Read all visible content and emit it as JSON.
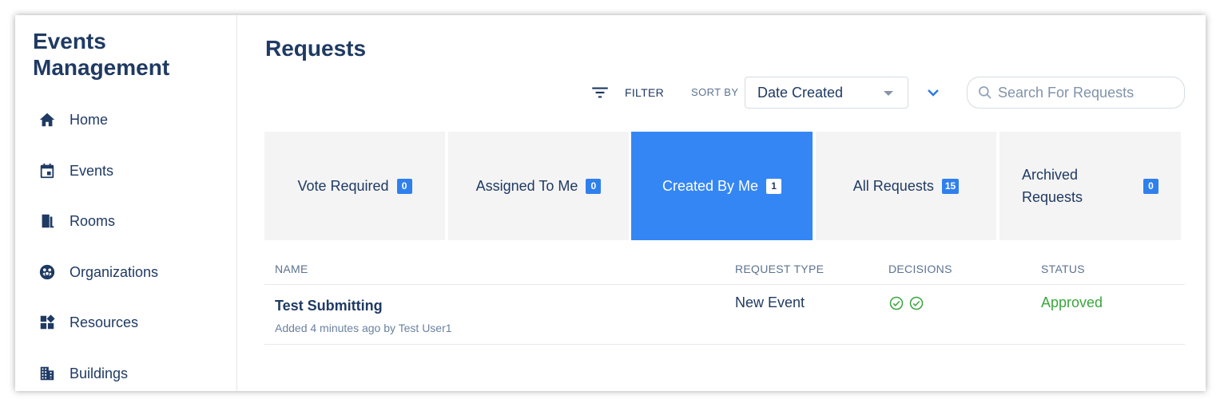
{
  "app": {
    "title": "Events Management"
  },
  "sidebar": {
    "items": [
      {
        "label": "Home",
        "icon": "home-icon"
      },
      {
        "label": "Events",
        "icon": "calendar-icon"
      },
      {
        "label": "Rooms",
        "icon": "door-icon"
      },
      {
        "label": "Organizations",
        "icon": "organizations-icon"
      },
      {
        "label": "Resources",
        "icon": "resources-icon"
      },
      {
        "label": "Buildings",
        "icon": "building-icon"
      }
    ]
  },
  "page": {
    "title": "Requests"
  },
  "toolbar": {
    "filter_label": "FILTER",
    "sort_label": "SORT BY",
    "sort_value": "Date Created",
    "search_placeholder": "Search For Requests"
  },
  "tabs": [
    {
      "label": "Vote Required",
      "count": "0",
      "active": false
    },
    {
      "label": "Assigned To Me",
      "count": "0",
      "active": false
    },
    {
      "label": "Created By Me",
      "count": "1",
      "active": true
    },
    {
      "label": "All Requests",
      "count": "15",
      "active": false
    },
    {
      "label": "Archived Requests",
      "count": "0",
      "active": false
    }
  ],
  "table": {
    "columns": [
      "NAME",
      "REQUEST TYPE",
      "DECISIONS",
      "STATUS"
    ],
    "rows": [
      {
        "name": "Test Submitting",
        "meta": "Added 4 minutes ago by Test User1",
        "type": "New Event",
        "decisions": [
          "approved-check-icon",
          "approved-check-icon"
        ],
        "status": "Approved"
      }
    ]
  },
  "colors": {
    "primary_text": "#1f3a63",
    "accent_blue": "#3586f5",
    "status_approved": "#3aa53d"
  }
}
